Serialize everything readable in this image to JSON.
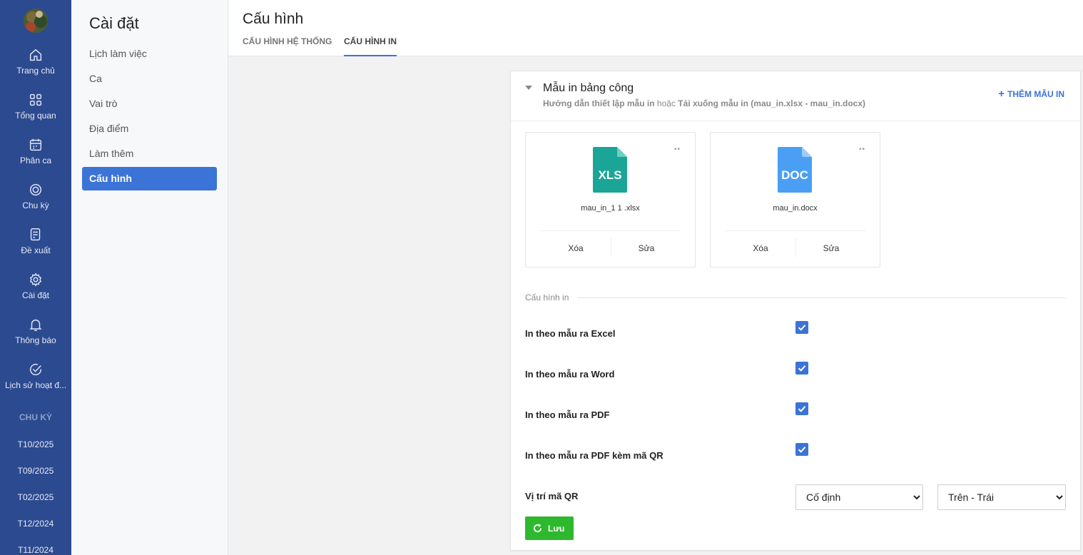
{
  "rail": {
    "items": [
      {
        "label": "Trang chủ",
        "icon": "home-icon"
      },
      {
        "label": "Tổng quan",
        "icon": "grid-icon"
      },
      {
        "label": "Phân ca",
        "icon": "calendar-icon"
      },
      {
        "label": "Chu kỳ",
        "icon": "cycle-icon"
      },
      {
        "label": "Đề xuất",
        "icon": "proposal-icon"
      },
      {
        "label": "Cài đặt",
        "icon": "gear-icon"
      },
      {
        "label": "Thông báo",
        "icon": "bell-icon"
      },
      {
        "label": "Lịch sử hoạt đ...",
        "icon": "check-circle-icon"
      }
    ],
    "cycle_heading": "CHU KỲ",
    "cycles": [
      "T10/2025",
      "T09/2025",
      "T02/2025",
      "T12/2024",
      "T11/2024"
    ]
  },
  "sidebar": {
    "title": "Cài đặt",
    "items": [
      "Lịch làm việc",
      "Ca",
      "Vai trò",
      "Địa điểm",
      "Làm thêm",
      "Cấu hình"
    ],
    "active_index": 5
  },
  "header": {
    "title": "Cấu hình",
    "tabs": [
      "CẤU HÌNH HỆ THỐNG",
      "CẤU HÌNH IN"
    ],
    "active_tab": 1
  },
  "card": {
    "title": "Mẫu in bảng công",
    "subtitle_guide": "Hướng dẫn thiết lập mẫu in",
    "subtitle_or": "hoặc",
    "subtitle_download": "Tải xuống mẫu in (mau_in.xlsx - mau_in.docx)",
    "add_label": "THÊM MẪU IN",
    "add_plus": "+",
    "templates": [
      {
        "file_type": "XLS",
        "file_name": "mau_in_1 1 .xlsx",
        "color": "#1aa596",
        "delete": "Xóa",
        "edit": "Sửa",
        "menu": "••"
      },
      {
        "file_type": "DOC",
        "file_name": "mau_in.docx",
        "color": "#4a9ff5",
        "delete": "Xóa",
        "edit": "Sửa",
        "menu": "••"
      }
    ],
    "section_label": "Cấu hình in",
    "options": [
      {
        "label": "In theo mẫu ra Excel",
        "checked": true
      },
      {
        "label": "In theo mẫu ra Word",
        "checked": true
      },
      {
        "label": "In theo mẫu ra PDF",
        "checked": true
      },
      {
        "label": "In theo mẫu ra PDF kèm mã QR",
        "checked": true
      }
    ],
    "qr_position_label": "Vị trí mã QR",
    "qr_mode": "Cố định",
    "qr_corner": "Trên - Trái",
    "save_label": "Lưu"
  },
  "colors": {
    "rail": "#2c4a8f",
    "accent": "#3c73d6",
    "save": "#2eb82e"
  }
}
